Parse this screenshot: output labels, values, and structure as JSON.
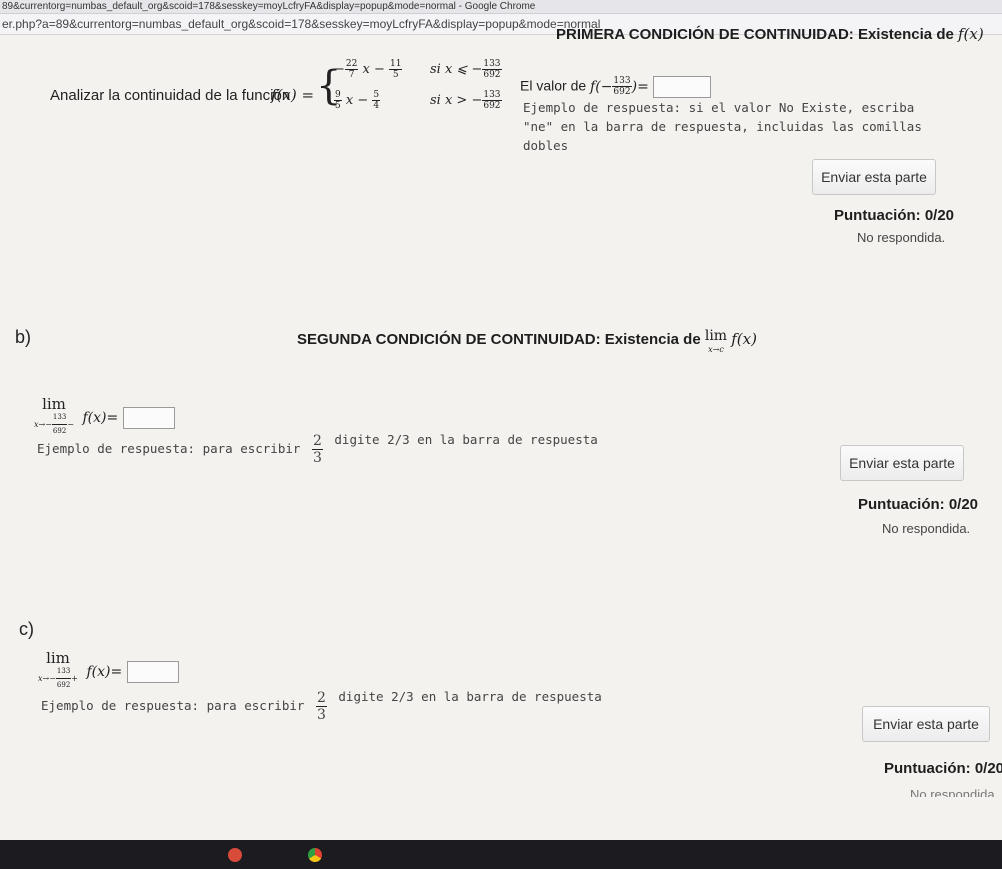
{
  "window": {
    "title": "89&currentorg=numbas_default_org&scoid=178&sesskey=moyLcfryFA&display=popup&mode=normal - Google Chrome",
    "url": "er.php?a=89&currentorg=numbas_default_org&scoid=178&sesskey=moyLcfryFA&display=popup&mode=normal"
  },
  "part_a": {
    "heading": "PRIMERA CONDICIÓN DE CONTINUIDAD: Existencia de",
    "heading_math": "f(x)",
    "analyze_text": "Analizar la continuidad de la función",
    "func_lhs": "f(x) =",
    "piece1": {
      "coef_num": "22",
      "coef_den": "7",
      "var": "x −",
      "const_num": "11",
      "const_den": "5",
      "cond": "si x ⩽ −",
      "cond_num": "133",
      "cond_den": "692",
      "lead": "−"
    },
    "piece2": {
      "coef_num": "9",
      "coef_den": "5",
      "var": "x −",
      "const_num": "5",
      "const_den": "4",
      "cond": "si x > −",
      "cond_num": "133",
      "cond_den": "692"
    },
    "value_label": "El valor de",
    "value_expr_pre": "f(−",
    "value_num": "133",
    "value_den": "692",
    "value_expr_post": ")=",
    "input_value": "",
    "hint": [
      "Ejemplo de respuesta: si el valor No Existe, escriba",
      "\"ne\" en la barra de respuesta, incluidas las comillas",
      "dobles"
    ],
    "submit_label": "Enviar esta parte",
    "score": "Puntuación: 0/20",
    "status": "No respondida."
  },
  "part_b": {
    "letter": "b)",
    "heading": "SEGUNDA CONDICIÓN DE CONTINUIDAD: Existencia de",
    "heading_lim": "lim",
    "heading_sub": "x→c",
    "heading_func": "f(x)",
    "lim": "lim",
    "lim_sub_pre": "x→−",
    "lim_num": "133",
    "lim_den": "692",
    "lim_side": "−",
    "func": "f(x)=",
    "input_value": "",
    "hint_pre": "Ejemplo de respuesta: para escribir",
    "hint_num": "2",
    "hint_den": "3",
    "hint_post": "digite 2/3 en la barra de respuesta",
    "submit_label": "Enviar esta parte",
    "score": "Puntuación: 0/20",
    "status": "No respondida."
  },
  "part_c": {
    "letter": "c)",
    "lim": "lim",
    "lim_sub_pre": "x→−",
    "lim_num": "133",
    "lim_den": "692",
    "lim_side": "+",
    "func": "f(x)=",
    "input_value": "",
    "hint_pre": "Ejemplo de respuesta: para escribir",
    "hint_num": "2",
    "hint_den": "3",
    "hint_post": "digite 2/3 en la barra de respuesta",
    "submit_label": "Enviar esta parte",
    "score": "Puntuación: 0/20",
    "status": "No respondida"
  },
  "taskbar": {
    "icons": [
      "app-icon-red",
      "app-icon-chrome"
    ]
  }
}
